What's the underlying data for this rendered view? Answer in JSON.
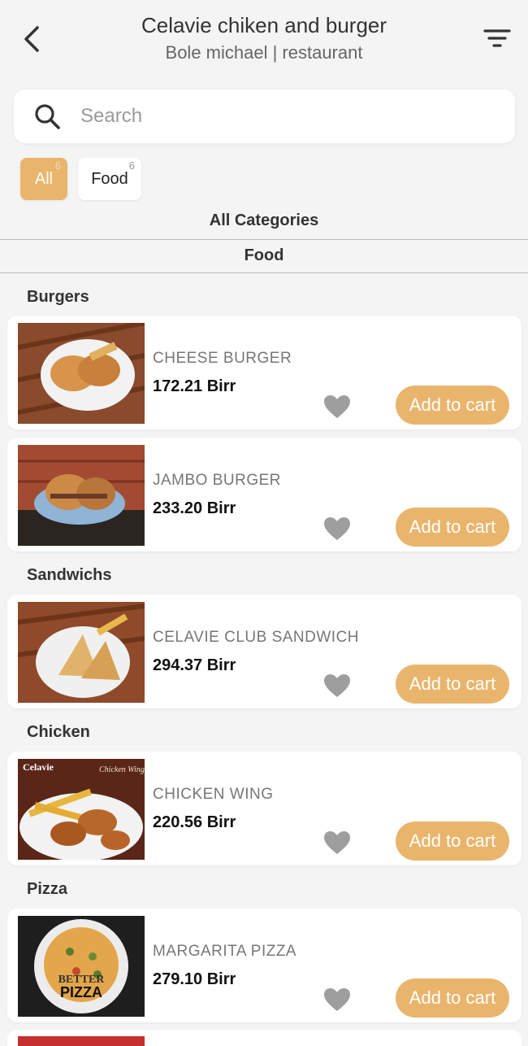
{
  "header": {
    "title": "Celavie chiken and burger",
    "subtitle": "Bole michael | restaurant"
  },
  "search": {
    "placeholder": "Search"
  },
  "chips": [
    {
      "label": "All",
      "count": "6"
    },
    {
      "label": "Food",
      "count": "6"
    }
  ],
  "categories": {
    "all": "All Categories",
    "food": "Food"
  },
  "sections": [
    {
      "title": "Burgers",
      "items": [
        {
          "name": "CHEESE BURGER",
          "price": "172.21 Birr",
          "button": "Add to cart"
        },
        {
          "name": "JAMBO BURGER",
          "price": "233.20 Birr",
          "button": "Add to cart"
        }
      ]
    },
    {
      "title": "Sandwichs",
      "items": [
        {
          "name": "CELAVIE CLUB SANDWICH",
          "price": "294.37 Birr",
          "button": "Add to cart"
        }
      ]
    },
    {
      "title": "Chicken",
      "items": [
        {
          "name": "CHICKEN WING",
          "price": "220.56 Birr",
          "button": "Add to cart"
        }
      ]
    },
    {
      "title": "Pizza",
      "items": [
        {
          "name": "MARGARITA PIZZA",
          "price": "279.10 Birr",
          "button": "Add to cart"
        }
      ]
    }
  ],
  "thumb_texts": {
    "celavie_logo": "Celavie",
    "chicken_wings": "Chicken Wings",
    "better": "BETTER",
    "pizza": "PIZZA"
  },
  "colors": {
    "accent": "#e9b56c",
    "heart": "#9e9e9e",
    "background": "#f4f4f5"
  }
}
